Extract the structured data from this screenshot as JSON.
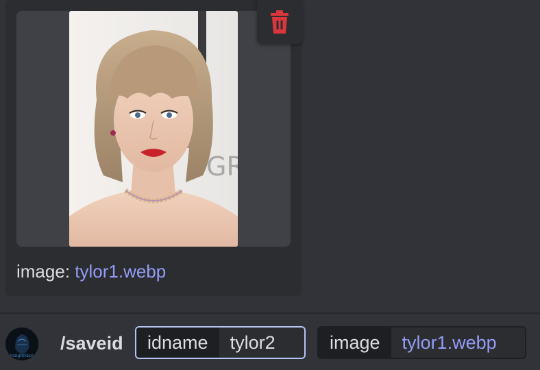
{
  "attachment": {
    "caption_key": "image: ",
    "caption_value": "tylor1.webp",
    "photo_icon": "image-preview-icon",
    "photo_watermark_text": "GR",
    "delete_icon": "trash-icon"
  },
  "command": {
    "avatar_label": "InsightFace",
    "name": "/saveid",
    "options": [
      {
        "key": "idname",
        "value": "tylor2"
      },
      {
        "key": "image",
        "value": "tylor1.webp"
      }
    ]
  },
  "colors": {
    "background": "#313338",
    "card": "#2b2d31",
    "link": "#949cf7",
    "delete_red": "#da373c",
    "focus_border": "#b5c4f1"
  }
}
